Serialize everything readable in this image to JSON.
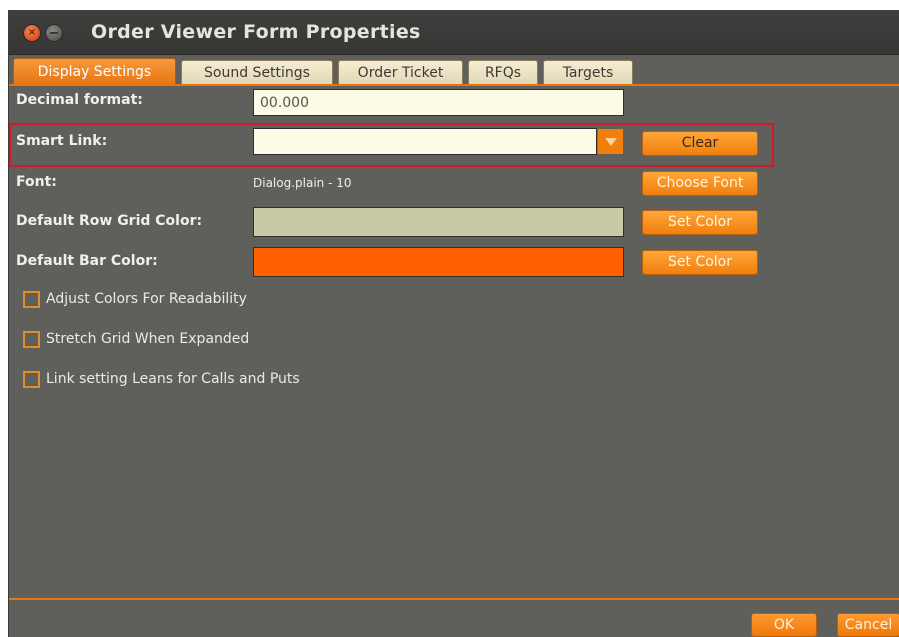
{
  "window": {
    "title": "Order Viewer Form Properties",
    "close_glyph": "×"
  },
  "tabs": [
    {
      "label": "Display Settings",
      "active": true
    },
    {
      "label": "Sound Settings",
      "active": false
    },
    {
      "label": "Order Ticket",
      "active": false
    },
    {
      "label": "RFQs",
      "active": false
    },
    {
      "label": "Targets",
      "active": false
    }
  ],
  "form": {
    "decimal_format": {
      "label": "Decimal format:",
      "value": "00.000"
    },
    "smart_link": {
      "label": "Smart Link:",
      "value": "",
      "button": "Clear"
    },
    "font": {
      "label": "Font:",
      "value": "Dialog.plain - 10",
      "button": "Choose Font"
    },
    "row_grid_color": {
      "label": "Default Row Grid Color:",
      "color": "#c7c9a7",
      "button": "Set Color"
    },
    "bar_color": {
      "label": "Default Bar Color:",
      "color": "#ff6000",
      "button": "Set Color"
    }
  },
  "checkboxes": [
    {
      "label": "Adjust Colors For Readability",
      "checked": false
    },
    {
      "label": "Stretch Grid When Expanded",
      "checked": false
    },
    {
      "label": "Link setting Leans for Calls and Puts",
      "checked": false
    }
  ],
  "footer": {
    "ok": "OK",
    "cancel": "Cancel"
  },
  "colors": {
    "accent": "#f07f0c",
    "background": "#5f5f5c",
    "highlight_border": "#d3162a"
  }
}
